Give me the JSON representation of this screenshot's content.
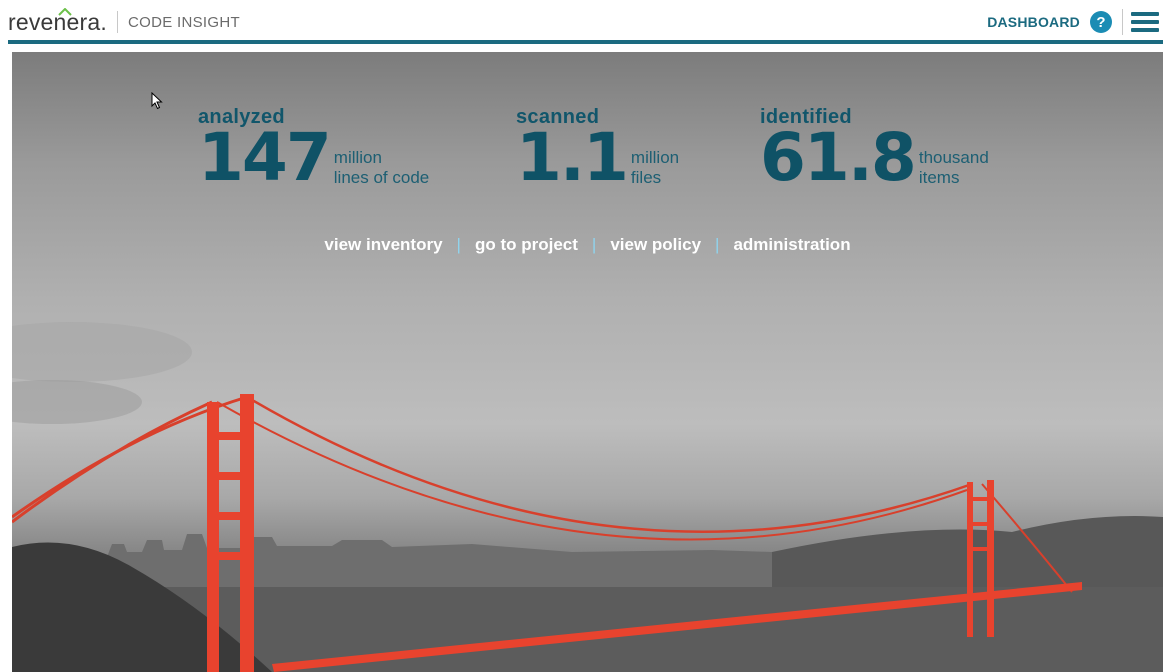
{
  "header": {
    "logo_text": "revenera.",
    "product_name": "CODE INSIGHT",
    "dashboard_label": "DASHBOARD",
    "help_glyph": "?",
    "menu_icon": "hamburger-menu-icon",
    "accent_color": "#1b6a80",
    "help_color": "#1b8cb4"
  },
  "stats": [
    {
      "label": "analyzed",
      "value": "147",
      "unit_line1": "million",
      "unit_line2": "lines of code"
    },
    {
      "label": "scanned",
      "value": "1.1",
      "unit_line1": "million",
      "unit_line2": "files"
    },
    {
      "label": "identified",
      "value": "61.8",
      "unit_line1": "thousand",
      "unit_line2": "items"
    }
  ],
  "links": [
    {
      "label": "view inventory"
    },
    {
      "label": "go to project"
    },
    {
      "label": "view policy"
    },
    {
      "label": "administration"
    }
  ],
  "separator": "|",
  "background": {
    "subject": "golden-gate-bridge-icon",
    "bridge_color": "#e8432e"
  }
}
